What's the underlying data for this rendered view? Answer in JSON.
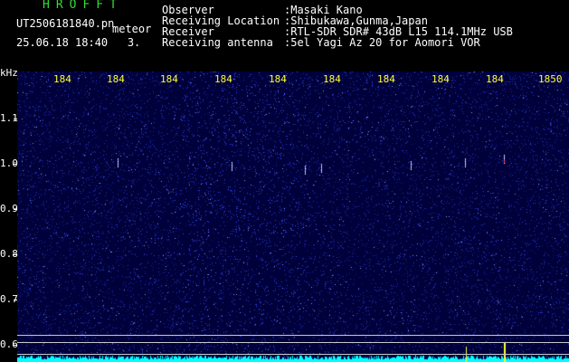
{
  "header": {
    "title": "HROFFT",
    "filename": "UT2506181840.pn",
    "tag": "meteor",
    "datetime": "25.06.18 18:40   3.",
    "fields": [
      {
        "label": "Observer",
        "value": ":Masaki Kano"
      },
      {
        "label": "Receiving Location",
        "value": ":Shibukawa,Gunma,Japan"
      },
      {
        "label": "Receiver",
        "value": ":RTL-SDR SDR# 43dB L15 114.1MHz USB"
      },
      {
        "label": "Receiving antenna",
        "value": ":5el Yagi Az 20 for Aomori VOR"
      }
    ]
  },
  "chart_data": {
    "type": "heatmap",
    "ylabel": "kHz",
    "y_ticks": [
      "1.1",
      "1.0",
      "0.9",
      "0.8",
      "0.7",
      "0.6"
    ],
    "x_ticks": [
      "184",
      "184",
      "184",
      "184",
      "184",
      "184",
      "184",
      "184",
      "184",
      "1850"
    ],
    "colors": {
      "background": "#00003a",
      "noise": "#3344cc",
      "baseline": "#00ffff",
      "marker": "#ffff33"
    }
  }
}
